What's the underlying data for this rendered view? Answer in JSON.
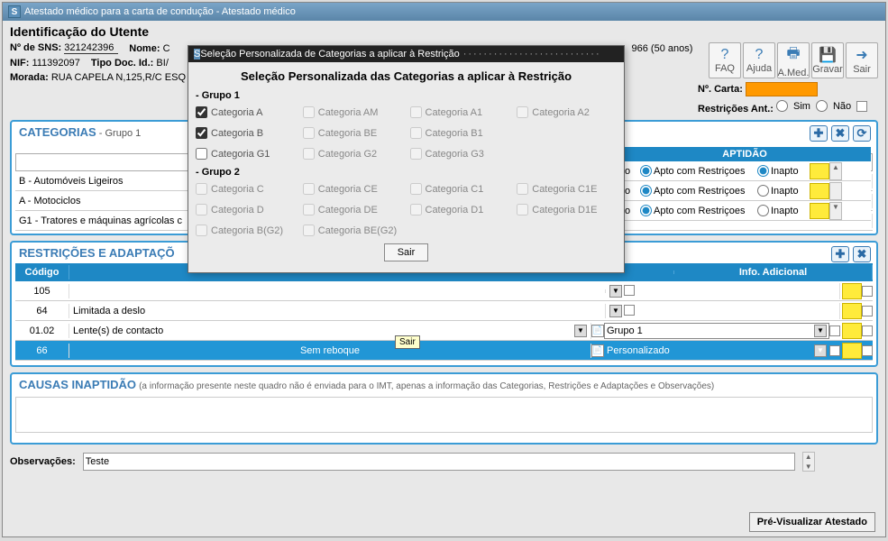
{
  "window_title": "Atestado médico para a carta de condução - Atestado médico",
  "ident": {
    "title": "Identificação do Utente",
    "sns_label": "Nº de SNS:",
    "sns": "321242396",
    "nome_label": "Nome:",
    "nome_partial": "C",
    "nif_label": "NIF:",
    "nif": "111392097",
    "tipo_doc_label": "Tipo Doc. Id.:",
    "tipo_doc": "BI/",
    "morada_label": "Morada:",
    "morada": "RUA CAPELA N,125,R/C ESQ",
    "age_fragment": "966 (50 anos)"
  },
  "toolbar": {
    "faq": "FAQ",
    "ajuda": "Ajuda",
    "amed": "A.Med.",
    "gravar": "Gravar",
    "sair": "Sair"
  },
  "side": {
    "carta_label": "Nº. Carta:",
    "restr_ant_label": "Restrições Ant.:",
    "sim": "Sim",
    "nao": "Não"
  },
  "categorias": {
    "title": "CATEGORIAS",
    "sub": "- Grupo 1",
    "rows": [
      "B - Automóveis Ligeiros",
      "A - Motociclos",
      "G1 - Tratores e máquinas agrícolas c"
    ],
    "apt_header": "APTIDÃO",
    "apt_partial": "to",
    "apto_com": "Apto com Restriçoes",
    "inapto": "Inapto"
  },
  "restricoes": {
    "title": "RESTRIÇÕES E ADAPTAÇÕ",
    "codigo": "Código",
    "info": "Info. Adicional",
    "rows": [
      {
        "cod": "105",
        "desc": "",
        "grupo": ""
      },
      {
        "cod": "64",
        "desc": "Limitada a deslo",
        "grupo": ""
      },
      {
        "cod": "01.02",
        "desc": "Lente(s) de contacto",
        "grupo": "Grupo 1"
      },
      {
        "cod": "66",
        "desc": "Sem reboque",
        "grupo": "Personalizado"
      }
    ]
  },
  "causas": {
    "title": "CAUSAS INAPTIDÃO",
    "note": "(a informação presente neste quadro não é enviada para o IMT, apenas a informação das Categorias, Restrições e Adaptações e Observações)"
  },
  "obs": {
    "label": "Observações:",
    "value": "Teste"
  },
  "prev_btn": "Pré-Visualizar Atestado",
  "modal": {
    "title": "Seleção Personalizada de Categorias a aplicar à Restrição",
    "heading": "Seleção Personalizada das Categorias a aplicar à Restrição",
    "group1": "- Grupo 1",
    "group2": "- Grupo 2",
    "catA": "Categoria A",
    "catAM": "Categoria AM",
    "catA1": "Categoria A1",
    "catA2": "Categoria A2",
    "catB": "Categoria B",
    "catBE": "Categoria BE",
    "catB1": "Categoria B1",
    "catG1": "Categoria G1",
    "catG2": "Categoria G2",
    "catG3": "Categoria G3",
    "catC": "Categoria C",
    "catCE": "Categoria CE",
    "catC1": "Categoria C1",
    "catC1E": "Categoria C1E",
    "catD": "Categoria D",
    "catDE": "Categoria DE",
    "catD1": "Categoria D1",
    "catD1E": "Categoria D1E",
    "catBG2": "Categoria B(G2)",
    "catBEG2": "Categoria BE(G2)",
    "sair": "Sair"
  },
  "tooltip": "Sair"
}
